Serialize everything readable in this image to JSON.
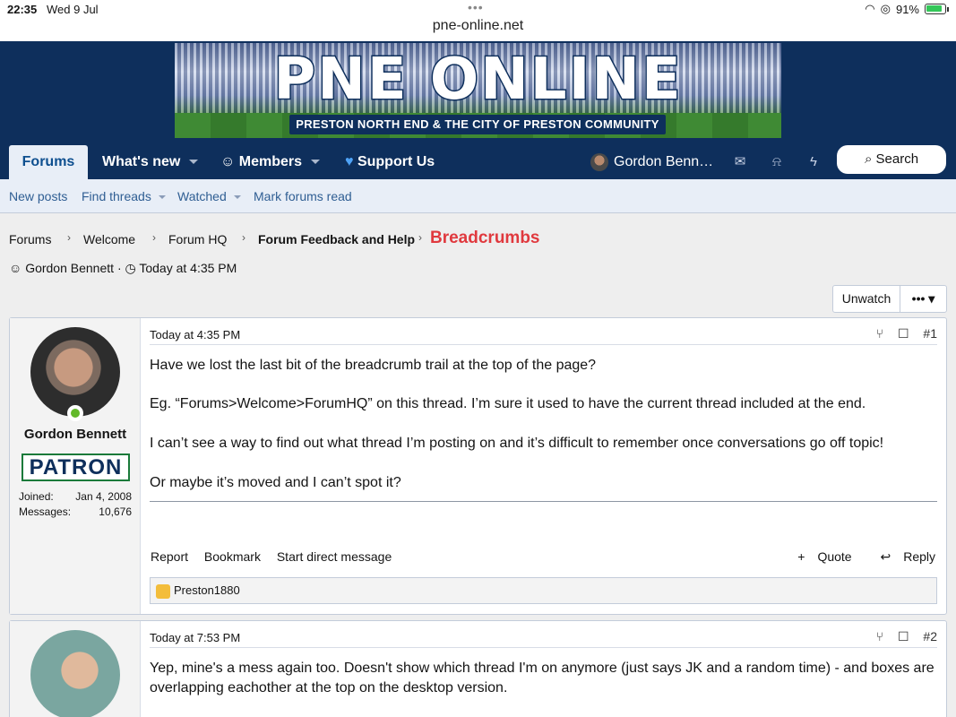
{
  "status_bar": {
    "time": "22:35",
    "date": "Wed 9 Jul",
    "dots": "•••",
    "url": "pne-online.net",
    "battery": "91%"
  },
  "banner": {
    "title": "PNE ONLINE",
    "subtitle": "PRESTON NORTH END & THE CITY OF PRESTON COMMUNITY"
  },
  "nav": {
    "forums": "Forums",
    "whats_new": "What's new",
    "members": "Members",
    "support": "Support Us",
    "user": "Gordon Benn…",
    "search": "Search"
  },
  "subnav": {
    "new_posts": "New posts",
    "find_threads": "Find threads",
    "watched": "Watched",
    "mark_read": "Mark forums read"
  },
  "breadcrumb": {
    "items": [
      "Forums",
      "Welcome",
      "Forum HQ",
      "Forum Feedback and Help"
    ],
    "current": "Breadcrumbs"
  },
  "thread_meta": {
    "author": "Gordon Bennett",
    "sep": "·",
    "time": "Today at 4:35 PM"
  },
  "buttons": {
    "unwatch": "Unwatch",
    "more": "•••"
  },
  "posts": [
    {
      "username": "Gordon Bennett",
      "badge": "PATRON",
      "joined_label": "Joined:",
      "joined": "Jan 4, 2008",
      "messages_label": "Messages:",
      "messages": "10,676",
      "date": "Today at 4:35 PM",
      "number": "#1",
      "paragraphs": [
        "Have we lost the last bit of the breadcrumb trail at the top of the page?",
        "Eg. “Forums>Welcome>ForumHQ” on this thread. I’m sure it used to have the current thread included at the end.",
        "I can’t see a way to find out what thread I’m posting on and it’s difficult to remember once conversations go off topic!",
        "Or maybe it’s moved and I can’t spot it?"
      ],
      "actions": {
        "report": "Report",
        "bookmark": "Bookmark",
        "message": "Start direct message",
        "quote": "Quote",
        "reply": "Reply"
      },
      "reaction_user": "Preston1880"
    },
    {
      "date": "Today at 7:53 PM",
      "number": "#2",
      "paragraphs": [
        "Yep, mine's a mess again too. Doesn't show which thread I'm on anymore (just says JK and a random time) - and boxes are overlapping eachother at the top on the desktop version."
      ]
    }
  ]
}
